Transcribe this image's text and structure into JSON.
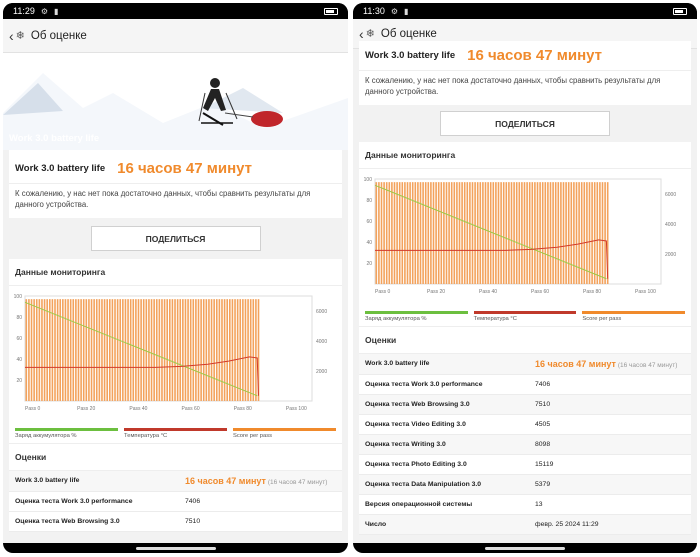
{
  "left": {
    "status_time": "11:29",
    "header_title": "Об оценке",
    "hero_label": "Work 3.0 battery life",
    "title_label": "Work 3.0 battery life",
    "title_value": "16 часов 47 минут",
    "note": "К сожалению, у нас нет пока достаточно данных, чтобы сравнить результаты для данного устройства.",
    "share_label": "ПОДЕЛИТЬСЯ",
    "monitoring_label": "Данные мониторинга",
    "results_label": "Оценки",
    "rows": [
      {
        "k": "Work 3.0 battery life",
        "v": "16 часов 47 минут",
        "sub": "(16 часов 47 минут)"
      },
      {
        "k": "Оценка теста Work 3.0 performance",
        "v": "7406"
      },
      {
        "k": "Оценка теста Web Browsing 3.0",
        "v": "7510"
      }
    ]
  },
  "right": {
    "status_time": "11:30",
    "header_title": "Об оценке",
    "title_label": "Work 3.0 battery life",
    "title_value": "16 часов 47 минут",
    "note": "К сожалению, у нас нет пока достаточно данных, чтобы сравнить результаты для данного устройства.",
    "share_label": "ПОДЕЛИТЬСЯ",
    "monitoring_label": "Данные мониторинга",
    "results_label": "Оценки",
    "rows": [
      {
        "k": "Work 3.0 battery life",
        "v": "16 часов 47 минут",
        "sub": "(16 часов 47 минут)"
      },
      {
        "k": "Оценка теста Work 3.0 performance",
        "v": "7406"
      },
      {
        "k": "Оценка теста Web Browsing 3.0",
        "v": "7510"
      },
      {
        "k": "Оценка теста Video Editing 3.0",
        "v": "4505"
      },
      {
        "k": "Оценка теста Writing 3.0",
        "v": "8098"
      },
      {
        "k": "Оценка теста Photo Editing 3.0",
        "v": "15119"
      },
      {
        "k": "Оценка теста Data Manipulation 3.0",
        "v": "5379"
      },
      {
        "k": "Версия операционной системы",
        "v": "13"
      },
      {
        "k": "Число",
        "v": "февр. 25 2024 11:29"
      }
    ]
  },
  "legend": [
    {
      "label": "Заряд аккумулятора %",
      "color": "#6cbf3f"
    },
    {
      "label": "Температура °C",
      "color": "#c0392b"
    },
    {
      "label": "Score per pass",
      "color": "#f08a2c"
    }
  ],
  "chart_data": {
    "type": "line",
    "x_ticks": [
      "Pass 0",
      "Pass 20",
      "Pass 40",
      "Pass 60",
      "Pass 80",
      "Pass 100"
    ],
    "y_left_ticks": [
      "20",
      "40",
      "60",
      "80",
      "100"
    ],
    "y_right_ticks": [
      "2000",
      "4000",
      "6000"
    ],
    "battery": {
      "x": [
        0,
        89
      ],
      "y": [
        94,
        5
      ]
    },
    "temperature": {
      "x": [
        0,
        50,
        60,
        70,
        78,
        86,
        89,
        89.5
      ],
      "y": [
        32,
        32,
        33,
        35,
        38,
        42,
        41,
        5
      ]
    },
    "passes": 90
  }
}
